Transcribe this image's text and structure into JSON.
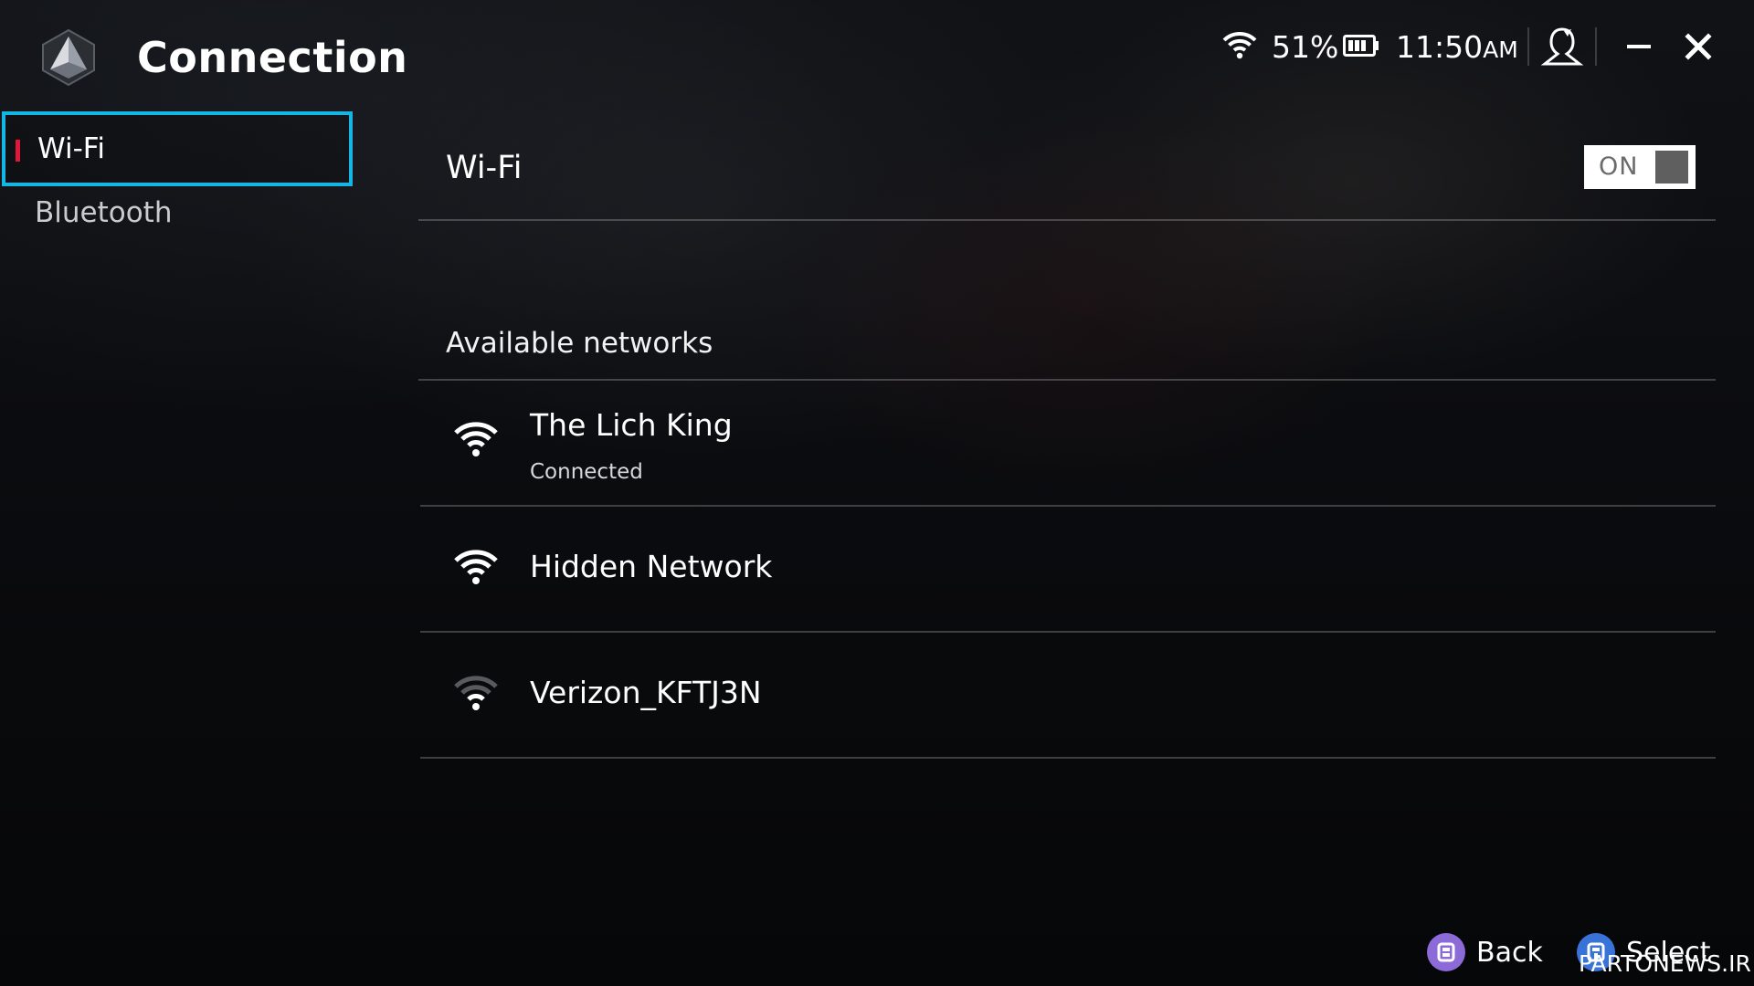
{
  "header": {
    "title": "Connection",
    "battery_percent": "51%",
    "time": "11:50",
    "time_suffix": "AM",
    "icons": [
      "app-logo-icon",
      "wifi-icon",
      "battery-icon",
      "profile-icon",
      "minimize-icon",
      "close-icon"
    ]
  },
  "sidebar": {
    "items": [
      {
        "label": "Wi-Fi",
        "selected": true
      },
      {
        "label": "Bluetooth",
        "selected": false
      }
    ]
  },
  "main": {
    "wifi_label": "Wi-Fi",
    "wifi_toggle": "ON",
    "available_label": "Available networks",
    "networks": [
      {
        "name": "The Lich King",
        "status": "Connected",
        "signal_icon": "wifi-full-icon"
      },
      {
        "name": "Hidden Network",
        "signal_icon": "wifi-full-icon"
      },
      {
        "name": "Verizon_KFTJ3N",
        "signal_icon": "wifi-weak-icon"
      }
    ]
  },
  "footer": {
    "back_label": "Back",
    "select_label": "Select",
    "watermark": "PARTONEWS.IR"
  },
  "colors": {
    "focus_border": "#14b7e4",
    "selected_accent": "#e2163b",
    "back_button": "#8c6ad8",
    "select_button": "#3a73d8"
  }
}
